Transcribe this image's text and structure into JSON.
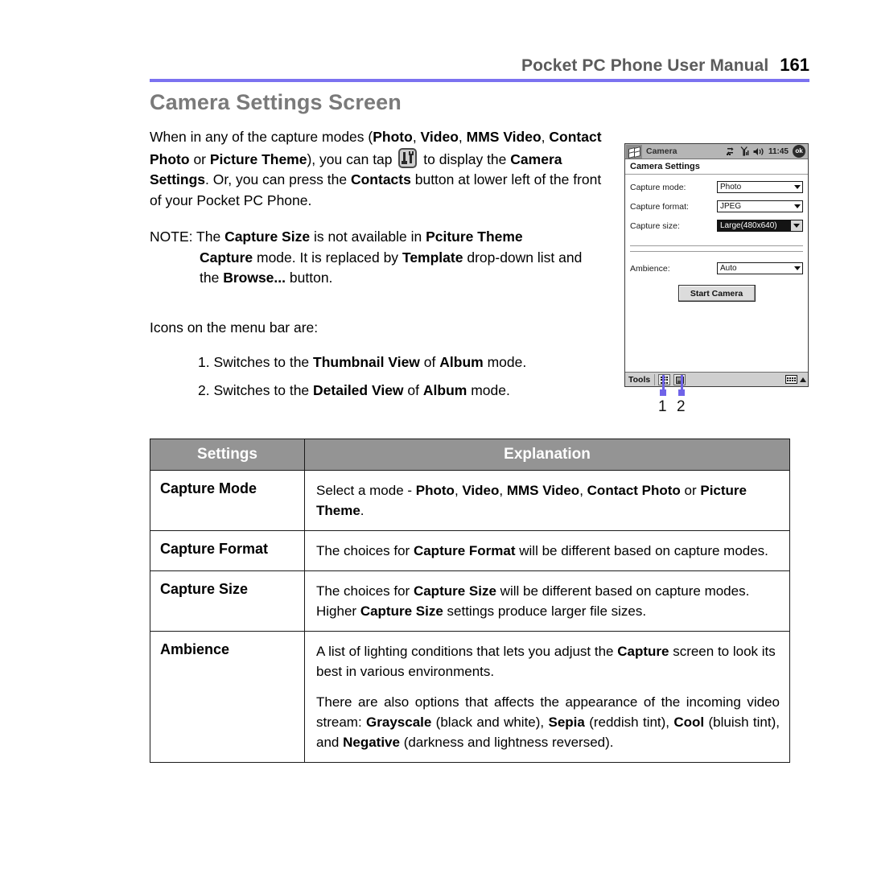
{
  "header": {
    "manual_title": "Pocket PC Phone User Manual",
    "page_number": "161",
    "rule_color": "#7b72f0"
  },
  "section": {
    "title": "Camera Settings Screen",
    "title_color": "#7a7a7a"
  },
  "body": {
    "paragraph1": {
      "part1": "When in any of the capture modes (",
      "bold1": "Photo",
      "sep1": ", ",
      "bold2": "Video",
      "sep2": ", ",
      "bold3": "MMS Video",
      "sep3": ", ",
      "bold4": "Contact Photo",
      "sep4": " or ",
      "bold5": "Picture Theme",
      "part2": "), you can tap",
      "part3": "to display the",
      "bold6": "Camera Settings",
      "part4": ".  Or, you can press the",
      "bold7": "Contacts",
      "part5": "button at lower left of the front of your Pocket PC Phone."
    },
    "note": {
      "prefix": "NOTE: The",
      "bold1": "Capture Size",
      "mid1": "is not available in",
      "bold2": "Pciture Theme",
      "bold3": "Capture",
      "mid2": "mode.  It is replaced by",
      "bold4": "Template",
      "mid3": "drop-down list and the",
      "bold5": "Browse...",
      "mid4": "button."
    },
    "icons_intro": "Icons on the menu bar are:",
    "numbered_items": [
      {
        "number": "1.",
        "pre": "Switches to the",
        "bold1": "Thumbnail View",
        "mid": "of",
        "bold2": "Album",
        "post": "mode."
      },
      {
        "number": "2.",
        "pre": "Switches to the",
        "bold1": "Detailed View",
        "mid": "of",
        "bold2": "Album",
        "post": "mode."
      }
    ],
    "inline_icon": "tools-settings-icon"
  },
  "pda": {
    "titlebar": {
      "start_icon": "windows-flag-icon",
      "app_title": "Camera",
      "connectivity_icon": "connectivity-arrows-icon",
      "signal_icon": "signal-bars-icon",
      "speaker_icon": "speaker-icon",
      "time": "11:45",
      "ok_label": "ok"
    },
    "screen_title": "Camera Settings",
    "fields": [
      {
        "label": "Capture mode:",
        "value": "Photo",
        "selected": false
      },
      {
        "label": "Capture format:",
        "value": "JPEG",
        "selected": false
      },
      {
        "label": "Capture size:",
        "value": "Large(480x640)",
        "selected": true
      },
      {
        "label": "Ambience:",
        "value": "Auto",
        "selected": false
      }
    ],
    "start_button": "Start Camera",
    "menubar": {
      "tools_label": "Tools",
      "icon1": "thumbnail-view-icon",
      "icon2": "detailed-view-icon",
      "keyboard_icon": "keyboard-icon",
      "up_arrow_icon": "chevron-up-icon"
    }
  },
  "callouts": {
    "color": "#6f63e8",
    "items": [
      {
        "label": "1"
      },
      {
        "label": "2"
      }
    ]
  },
  "table": {
    "header_bg": "#949494",
    "columns": [
      "Settings",
      "Explanation"
    ],
    "rows": [
      {
        "setting": "Capture Mode",
        "paragraphs": [
          {
            "justify": false,
            "segments": [
              {
                "text": "Select a mode - ",
                "bold": false
              },
              {
                "text": "Photo",
                "bold": true
              },
              {
                "text": ", ",
                "bold": false
              },
              {
                "text": "Video",
                "bold": true
              },
              {
                "text": ", ",
                "bold": false
              },
              {
                "text": "MMS Video",
                "bold": true
              },
              {
                "text": ", ",
                "bold": false
              },
              {
                "text": "Contact Photo",
                "bold": true
              },
              {
                "text": " or ",
                "bold": false
              },
              {
                "text": "Picture Theme",
                "bold": true
              },
              {
                "text": ".",
                "bold": false
              }
            ]
          }
        ]
      },
      {
        "setting": "Capture Format",
        "paragraphs": [
          {
            "justify": true,
            "segments": [
              {
                "text": "The choices for ",
                "bold": false
              },
              {
                "text": "Capture Format",
                "bold": true
              },
              {
                "text": " will be different based on capture modes.",
                "bold": false
              }
            ]
          }
        ]
      },
      {
        "setting": "Capture Size",
        "paragraphs": [
          {
            "justify": false,
            "segments": [
              {
                "text": "The choices for ",
                "bold": false
              },
              {
                "text": "Capture Size",
                "bold": true
              },
              {
                "text": " will be different based on capture modes. Higher ",
                "bold": false
              },
              {
                "text": "Capture Size",
                "bold": true
              },
              {
                "text": " settings produce larger file sizes.",
                "bold": false
              }
            ]
          }
        ]
      },
      {
        "setting": "Ambience",
        "paragraphs": [
          {
            "justify": false,
            "segments": [
              {
                "text": "A list of lighting conditions that lets you adjust the ",
                "bold": false
              },
              {
                "text": "Capture",
                "bold": true
              },
              {
                "text": " screen to look its best in various environments.",
                "bold": false
              }
            ]
          },
          {
            "justify": true,
            "segments": [
              {
                "text": "There are also options that affects the appearance of the incoming video stream: ",
                "bold": false
              },
              {
                "text": "Grayscale",
                "bold": true
              },
              {
                "text": " (black and white), ",
                "bold": false
              },
              {
                "text": "Sepia",
                "bold": true
              },
              {
                "text": " (reddish tint), ",
                "bold": false
              },
              {
                "text": "Cool",
                "bold": true
              },
              {
                "text": " (bluish tint), and ",
                "bold": false
              },
              {
                "text": "Negative",
                "bold": true
              },
              {
                "text": " (darkness and lightness reversed).",
                "bold": false
              }
            ]
          }
        ]
      }
    ]
  }
}
